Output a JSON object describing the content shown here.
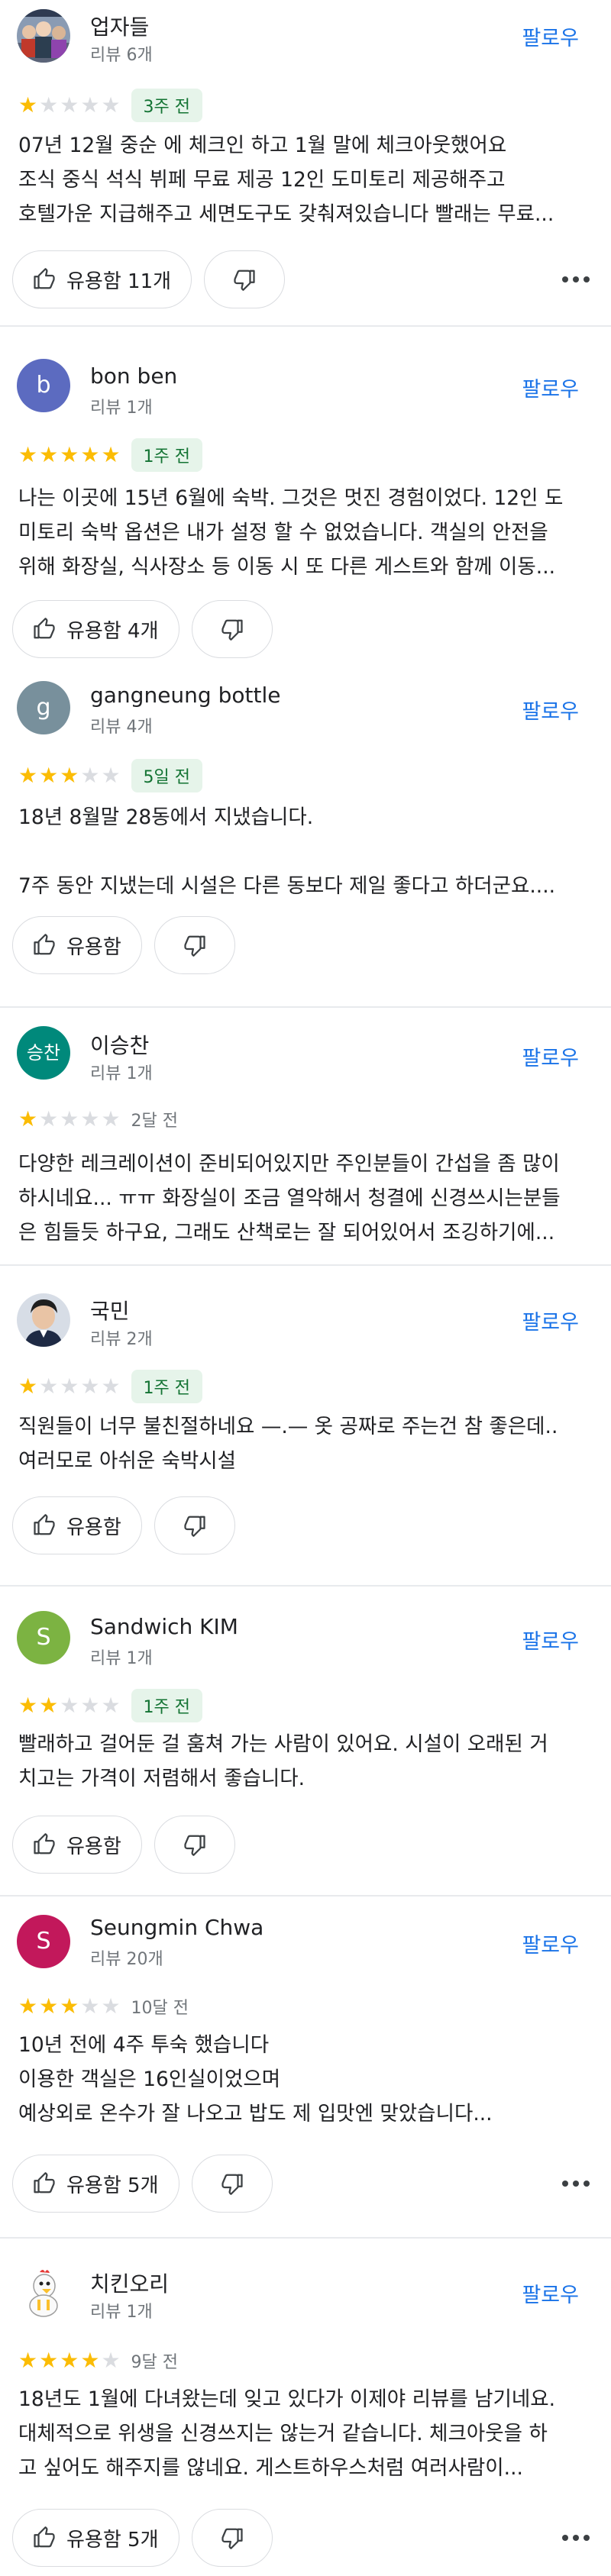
{
  "follow_label": "팔로우",
  "colors": {
    "star": "#fbbc04",
    "link": "#1a73e8",
    "recent_date_bg": "#e6f4ea",
    "recent_date_text": "#137333"
  },
  "reviews": [
    {
      "name": "업자들",
      "review_count": "리뷰 6개",
      "avatar": {
        "type": "image",
        "icon": "group-photo-avatar"
      },
      "rating": 1,
      "date": "3주 전",
      "date_style": "pill",
      "text_lines": [
        "07년 12월 중순 에 체크인 하고 1월 말에 체크아웃했어요",
        "조식 중식 석식 뷔페 무료 제공 12인 도미토리 제공해주고",
        "호텔가운 지급해주고 세면도구도 갖춰져있습니다 빨래는 무료..."
      ],
      "helpful_label": "유용함 11개"
    },
    {
      "name": "bon ben",
      "review_count": "리뷰 1개",
      "avatar": {
        "type": "letter",
        "letter": "b",
        "color": "#5c6bc0"
      },
      "rating": 5,
      "date": "1주 전",
      "date_style": "pill",
      "text_lines": [
        "나는 이곳에 15년 6월에 숙박. 그것은 멋진 경험이었다. 12인 도",
        "미토리 숙박 옵션은 내가 설정 할 수 없었습니다. 객실의 안전을",
        "위해 화장실, 식사장소 등 이동 시 또 다른 게스트와 함께 이동..."
      ],
      "helpful_label": "유용함 4개"
    },
    {
      "name": "gangneung bottle",
      "review_count": "리뷰 4개",
      "avatar": {
        "type": "letter",
        "letter": "g",
        "color": "#78909c"
      },
      "rating": 3,
      "date": "5일 전",
      "date_style": "pill",
      "text_lines": [
        "18년 8월말 28동에서 지냈습니다.",
        "",
        "7주 동안 지냈는데 시설은 다른 동보다 제일 좋다고 하더군요...."
      ],
      "helpful_label": "유용함"
    },
    {
      "name": "이승찬",
      "review_count": "리뷰 1개",
      "avatar": {
        "type": "letter",
        "letter": "승찬",
        "color": "#00897b"
      },
      "rating": 1,
      "date": "2달 전",
      "date_style": "plain",
      "text_lines": [
        "다양한 레크레이션이 준비되어있지만 주인분들이 간섭을 좀 많이",
        "하시네요... ㅠㅠ 화장실이 조금 열악해서 청결에 신경쓰시는분들",
        "은 힘들듯 하구요, 그래도 산책로는 잘 되어있어서 조깅하기에..."
      ],
      "helpful_label": null
    },
    {
      "name": "국민",
      "review_count": "리뷰 2개",
      "avatar": {
        "type": "image",
        "icon": "person-photo-avatar"
      },
      "rating": 1,
      "date": "1주 전",
      "date_style": "pill",
      "text_lines": [
        "직원들이 너무 불친절하네요 —.— 옷 공짜로 주는건 참 좋은데..",
        "여러모로 아쉬운 숙박시설"
      ],
      "helpful_label": "유용함"
    },
    {
      "name": "Sandwich KIM",
      "review_count": "리뷰 1개",
      "avatar": {
        "type": "letter",
        "letter": "S",
        "color": "#7cb342"
      },
      "rating": 2,
      "date": "1주 전",
      "date_style": "pill",
      "text_lines": [
        "빨래하고 걸어둔 걸 훔쳐 가는 사람이 있어요. 시설이 오래된 거",
        "치고는 가격이  저렴해서 좋습니다."
      ],
      "helpful_label": "유용함"
    },
    {
      "name": "Seungmin Chwa",
      "review_count": "리뷰 20개",
      "avatar": {
        "type": "letter",
        "letter": "S",
        "color": "#c2185b"
      },
      "rating": 3,
      "date": "10달 전",
      "date_style": "plain",
      "text_lines": [
        "10년 전에 4주 투숙 했습니다",
        "이용한 객실은 16인실이었으며",
        "예상외로 온수가 잘 나오고 밥도 제 입맛엔 맞았습니다..."
      ],
      "helpful_label": "유용함 5개"
    },
    {
      "name": "치킨오리",
      "review_count": "리뷰 1개",
      "avatar": {
        "type": "image",
        "icon": "chicken-duck-avatar"
      },
      "rating": 4,
      "date": "9달 전",
      "date_style": "plain",
      "text_lines": [
        "18년도 1월에 다녀왔는데 잊고 있다가 이제야 리뷰를 남기네요.",
        "대체적으로 위생을 신경쓰지는 않는거 같습니다. 체크아웃을 하",
        "고 싶어도 해주지를 않네요. 게스트하우스처럼 여러사람이..."
      ],
      "helpful_label": "유용함 5개"
    }
  ]
}
